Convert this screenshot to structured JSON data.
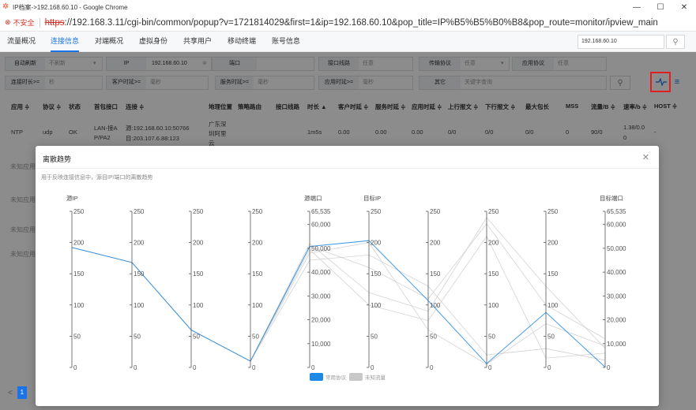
{
  "window": {
    "title": "IP档案->192.168.60.10 - Google Chrome",
    "controls": [
      "—",
      "☐",
      "✕"
    ]
  },
  "address": {
    "security_label": "不安全",
    "url_scheme": "https",
    "url_rest": "://192.168.3.11/cgi-bin/common/popup?v=1721814029&first=1&ip=192.168.60.10&pop_title=IP%B5%B5%B0%B8&pop_route=monitor/ipview_main"
  },
  "tabs": [
    "流量概况",
    "连接信息",
    "对端概况",
    "虚拟身份",
    "共享用户",
    "移动终端",
    "账号信息"
  ],
  "active_tab": "连接信息",
  "ip_search": {
    "value": "192.168.60.10"
  },
  "filters": {
    "auto_refresh_label": "自动刷新",
    "auto_refresh_value": "不刷新",
    "ip_label": "IP",
    "ip_value": "192.168.60.10",
    "port_label": "端口",
    "port_value": "",
    "iface_label": "接口线路",
    "iface_value": "任意",
    "proto_label": "传输协议",
    "proto_value": "任意",
    "app_proto_label": "应用协议",
    "app_proto_value": "任意",
    "dur_label": "连接时长>=",
    "dur_value": "秒",
    "client_rtt_label": "客户时延>=",
    "client_rtt_value": "毫秒",
    "server_rtt_label": "服务时延>=",
    "server_rtt_value": "毫秒",
    "app_rtt_label": "应用时延>=",
    "app_rtt_value": "毫秒",
    "other_label": "其它",
    "other_placeholder": "关键字查询"
  },
  "table": {
    "headers": [
      "应用 ≑",
      "协议 ≑",
      "状态",
      "首包接口",
      "连接 ≑",
      "地理位置",
      "策略路由",
      "接口线路",
      "时长 ▲",
      "客户时延 ≑",
      "服务时延 ≑",
      "应用时延 ≑",
      "上行报文 ≑",
      "下行报文 ≑",
      "最大包长",
      "MSS",
      "流量/B ≑",
      "速率/b ≑",
      "HOST ≑"
    ],
    "row": {
      "app": "NTP",
      "proto": "udp",
      "status": "OK",
      "iface1": "LAN-接A",
      "iface2": "P/PA2",
      "conn1": "源:192.168.60.10:50766",
      "conn2": "目:203.107.6.88:123",
      "geo1": "广东深",
      "geo2": "圳阿里",
      "geo3": "云",
      "duration": "1m5s",
      "crtt": "0.00",
      "srtt": "0.00",
      "artt": "0.00",
      "up": "0/0",
      "down": "0/0",
      "maxpkt": "0/0",
      "mss": "0",
      "traffic": "90/0",
      "rate1": "1.38/0.0",
      "rate2": "0",
      "host": "-"
    },
    "bg_rows": [
      "未知应用",
      "未知应用",
      "未知应用",
      "未知应用"
    ]
  },
  "pager": {
    "prev": "<",
    "page": "1"
  },
  "modal": {
    "title": "离散趋势",
    "subtitle": "用于反映连接信息中，源目IP/端口的离散趋势",
    "close": "✕"
  },
  "chart_data": {
    "type": "parallel-coordinates",
    "axes": [
      {
        "name": "源IP",
        "max": 250,
        "ticks": [
          250,
          200,
          150,
          100,
          50,
          0
        ]
      },
      {
        "name": "",
        "max": 250,
        "ticks": [
          250,
          200,
          150,
          100,
          50,
          0
        ]
      },
      {
        "name": "",
        "max": 250,
        "ticks": [
          250,
          200,
          150,
          100,
          50,
          0
        ]
      },
      {
        "name": "",
        "max": 250,
        "ticks": [
          250,
          200,
          150,
          100,
          50,
          0
        ]
      },
      {
        "name": "源端口",
        "max": 65535,
        "ticks": [
          "65,535",
          "60,000",
          "50,000",
          "40,000",
          "30,000",
          "20,000",
          "10,000",
          "0"
        ],
        "tick_values": [
          65535,
          60000,
          50000,
          40000,
          30000,
          20000,
          10000,
          0
        ]
      },
      {
        "name": "目标IP",
        "max": 250,
        "ticks": [
          250,
          200,
          150,
          100,
          50,
          0
        ]
      },
      {
        "name": "",
        "max": 250,
        "ticks": [
          250,
          200,
          150,
          100,
          50,
          0
        ]
      },
      {
        "name": "",
        "max": 250,
        "ticks": [
          250,
          200,
          150,
          100,
          50,
          0
        ]
      },
      {
        "name": "",
        "max": 250,
        "ticks": [
          250,
          200,
          150,
          100,
          50,
          0
        ]
      },
      {
        "name": "目标端口",
        "max": 65535,
        "ticks": [
          "65,535",
          "60,000",
          "50,000",
          "40,000",
          "30,000",
          "20,000",
          "10,000",
          "0"
        ],
        "tick_values": [
          65535,
          60000,
          50000,
          40000,
          30000,
          20000,
          10000,
          0
        ]
      }
    ],
    "series": [
      {
        "name": "常用协议",
        "color": "#1e88e5",
        "lines": [
          [
            192,
            168,
            60,
            10,
            50766,
            203,
            107,
            6,
            88,
            123
          ]
        ]
      },
      {
        "name": "未知流量",
        "color": "#c8c8c8",
        "lines": [
          [
            192,
            168,
            60,
            10,
            52000,
            120,
            90,
            240,
            130,
            8000
          ],
          [
            192,
            168,
            60,
            10,
            48000,
            200,
            60,
            5,
            70,
            9000
          ],
          [
            192,
            168,
            60,
            10,
            45000,
            180,
            130,
            20,
            30,
            3000
          ],
          [
            192,
            168,
            60,
            10,
            51000,
            160,
            110,
            230,
            100,
            12000
          ],
          [
            192,
            168,
            60,
            10,
            49500,
            100,
            75,
            210,
            15,
            6000
          ]
        ]
      }
    ],
    "legend": [
      "常用协议",
      "未知流量"
    ],
    "legend_colors": [
      "#1e88e5",
      "#c8c8c8"
    ]
  },
  "colors": {
    "accent": "#1a73e8",
    "highlight_box": "#e02020"
  }
}
